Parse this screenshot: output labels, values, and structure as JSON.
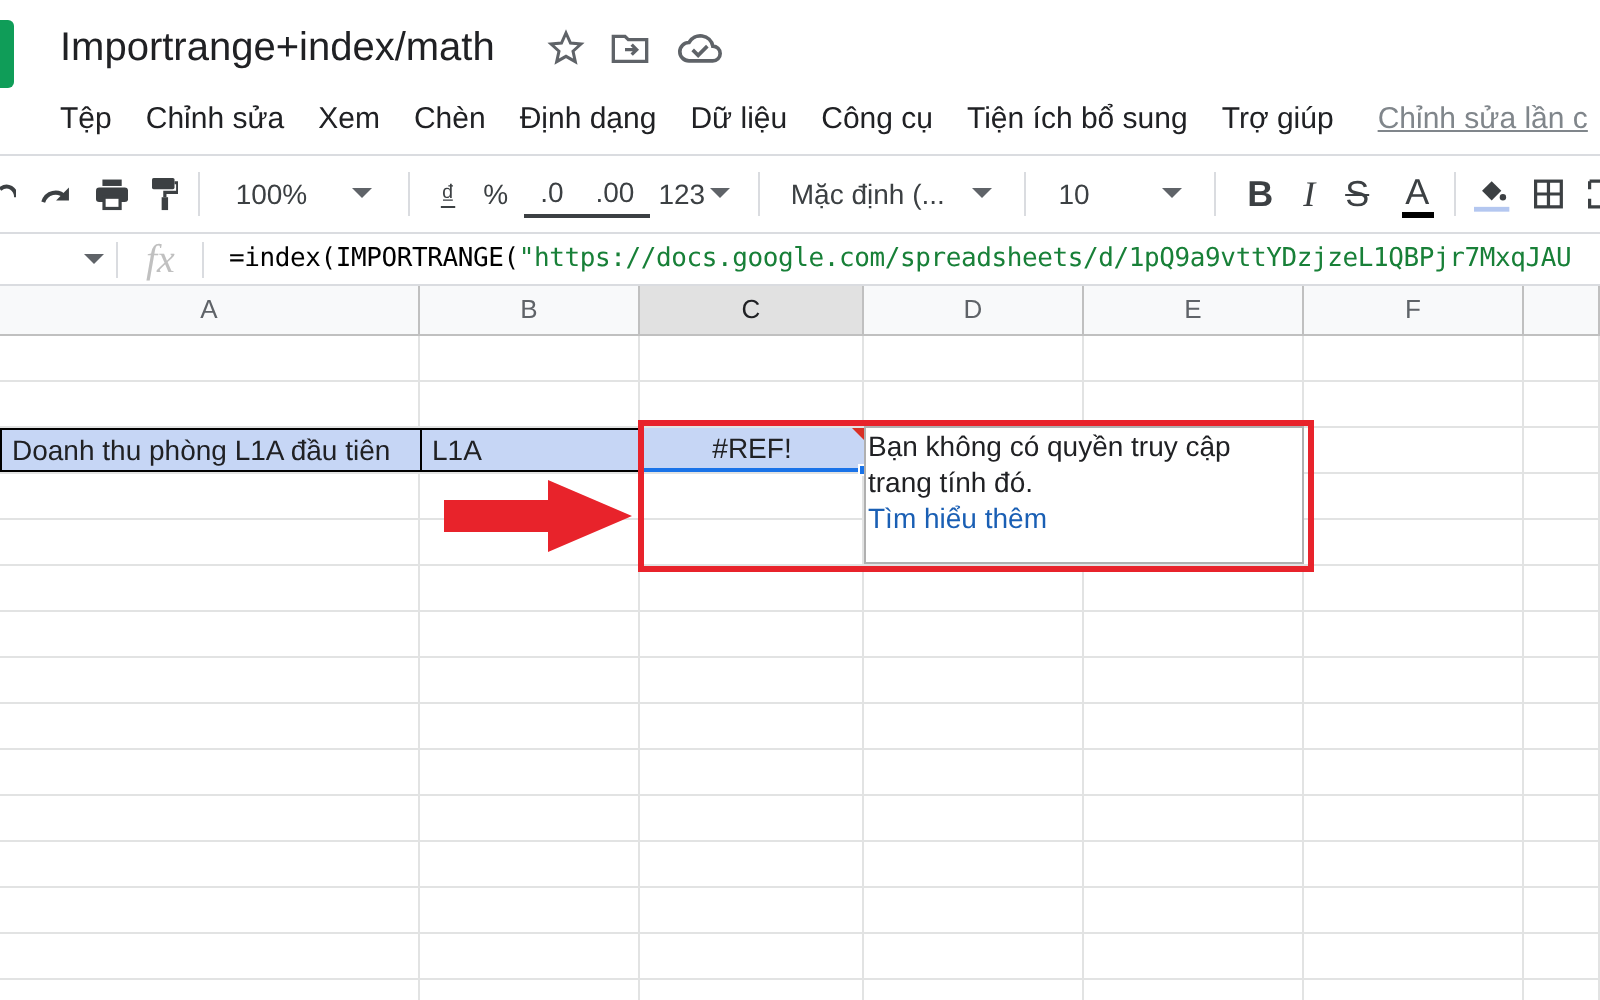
{
  "document": {
    "title": "Importrange+index/math"
  },
  "menu": [
    "Tệp",
    "Chỉnh sửa",
    "Xem",
    "Chèn",
    "Định dạng",
    "Dữ liệu",
    "Công cụ",
    "Tiện ích bổ sung",
    "Trợ giúp"
  ],
  "last_edit": "Chỉnh sửa lần c",
  "toolbar": {
    "zoom": "100%",
    "currency": "₫",
    "percent": "%",
    "decrease_decimal": ".0",
    "increase_decimal": ".00",
    "number_format": "123",
    "font": "Mặc định (...",
    "font_size": "10",
    "bold": "B",
    "italic": "I",
    "strikethrough": "S",
    "text_color": "A"
  },
  "formula_bar": {
    "fx": "fx",
    "formula": "=index(IMPORTRANGE(",
    "formula_string": "\"https://docs.google.com/spreadsheets/d/1pQ9a9vttYDzjzeL1QBPjr7MxqJAU"
  },
  "columns": [
    {
      "label": "A",
      "selected": false
    },
    {
      "label": "B",
      "selected": false
    },
    {
      "label": "C",
      "selected": true
    },
    {
      "label": "D",
      "selected": false
    },
    {
      "label": "E",
      "selected": false
    },
    {
      "label": "F",
      "selected": false
    }
  ],
  "data_row": {
    "cells": [
      {
        "text": "Doanh thu phòng L1A đầu tiên",
        "selected": false
      },
      {
        "text": "L1A",
        "selected": false
      },
      {
        "text": "#REF!",
        "selected": true
      }
    ]
  },
  "error_tooltip": {
    "message": "Bạn không có quyền truy cập trang tính đó.",
    "link": "Tìm hiểu thêm"
  }
}
